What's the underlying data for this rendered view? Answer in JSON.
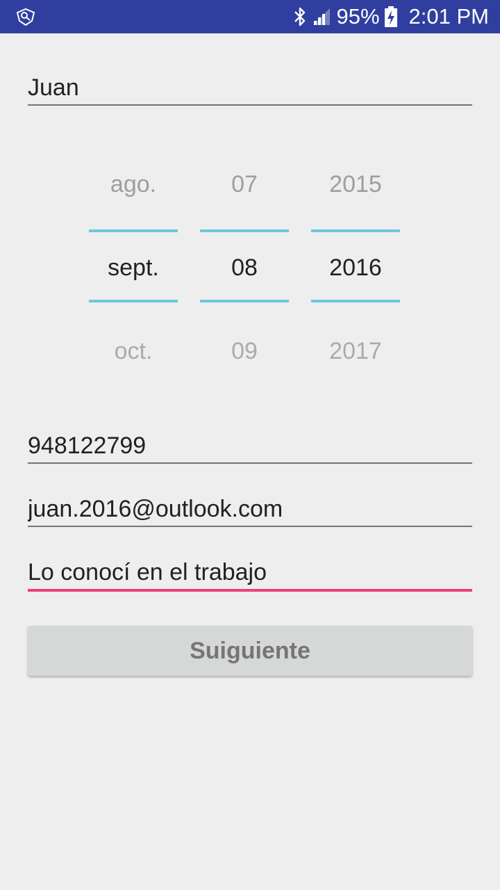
{
  "status_bar": {
    "left_icon": "notification-app-icon",
    "bluetooth_icon": "bluetooth-icon",
    "signal_icon": "signal-icon",
    "battery_percent": "95%",
    "battery_icon": "battery-charging-icon",
    "time": "2:01 PM"
  },
  "form": {
    "name_value": "Juan",
    "phone_value": "948122799",
    "email_value": "juan.2016@outlook.com",
    "note_value": "Lo conocí en el trabajo"
  },
  "date_picker": {
    "month": {
      "prev": "ago.",
      "current": "sept.",
      "next": "oct."
    },
    "day": {
      "prev": "07",
      "current": "08",
      "next": "09"
    },
    "year": {
      "prev": "2015",
      "current": "2016",
      "next": "2017"
    }
  },
  "actions": {
    "next_label": "Suiguiente"
  },
  "colors": {
    "status_bar": "#303f9f",
    "background": "#eeeeee",
    "picker_divider": "#6ec6e3",
    "focused_underline": "#ec407a",
    "button_bg": "#d6d7d7"
  }
}
